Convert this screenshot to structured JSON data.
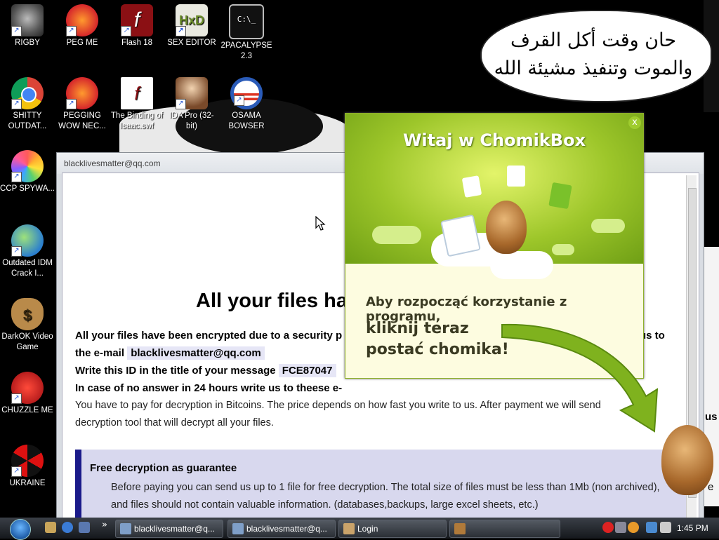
{
  "desktop": {
    "speech_bubble": "حان وقت أكل القرف والموت وتنفيذ مشيئة الله",
    "icons": [
      {
        "label": "RIGBY",
        "icon": "raccoon-icon"
      },
      {
        "label": "PEG ME",
        "icon": "p-logo-icon"
      },
      {
        "label": "Flash 18",
        "icon": "flash-icon"
      },
      {
        "label": "SEX EDITOR",
        "icon": "hxd-icon"
      },
      {
        "label": "2PACALYPSE 2.3",
        "icon": "terminal-icon"
      },
      {
        "label": "SHITTY OUTDAT...",
        "icon": "chrome-icon"
      },
      {
        "label": "PEGGING WOW NEC...",
        "icon": "p-logo-icon"
      },
      {
        "label": "The Binding of Isaac.swf",
        "icon": "swf-file-icon"
      },
      {
        "label": "IDA Pro (32-bit)",
        "icon": "ida-portrait-icon"
      },
      {
        "label": "OSAMA BOWSER",
        "icon": "obama-logo-icon"
      },
      {
        "label": "CCP SPYWA...",
        "icon": "color-wheel-icon"
      },
      {
        "label": "Outdated IDM Crack I...",
        "icon": "globe-download-icon"
      },
      {
        "label": "DarkOK Video Game",
        "icon": "money-bag-icon"
      },
      {
        "label": "CHUZZLE ME",
        "icon": "chuzzle-icon"
      },
      {
        "label": "UKRAINE",
        "icon": "radiation-icon"
      }
    ]
  },
  "ransom_window": {
    "title": "blacklivesmatter@qq.com",
    "heading": "All your files ha",
    "line1_bold": "All your files have been encrypted due to a security p",
    "line1_tail": "us to",
    "line2_prefix": "the e-mail",
    "line2_email": "blacklivesmatter@qq.com",
    "line3_prefix": "Write this ID in the title of your message",
    "line3_id": "FCE87047",
    "line4": "In case of no answer in 24 hours write us to theese e-",
    "line5": "You have to pay for decryption in Bitcoins. The price depends on how fast you write to us. After payment we will send",
    "line6": "decryption tool that will decrypt all your files.",
    "guarantee_heading": "Free decryption as guarantee",
    "guarantee_p1": "Before paying you can send us up to 1 file for free decryption. The total size of files must be less than 1Mb (non archived),",
    "guarantee_p2": "and files should not contain valuable information. (databases,backups, large excel sheets, etc.)"
  },
  "chomikbox_popup": {
    "title": "Witaj w ChomikBox",
    "close": "x",
    "line1": "Aby rozpocząć korzystanie z programu,",
    "line2a": "kliknij teraz",
    "line2b": "postać chomika!"
  },
  "side_fragments": {
    "right_us": "us",
    "right_e": "e"
  },
  "taskbar": {
    "buttons": [
      {
        "label": "blacklivesmatter@q..."
      },
      {
        "label": "blacklivesmatter@q..."
      },
      {
        "label": "Login"
      },
      {
        "label": ""
      }
    ],
    "chevron": "»",
    "clock": "1:45 PM"
  }
}
